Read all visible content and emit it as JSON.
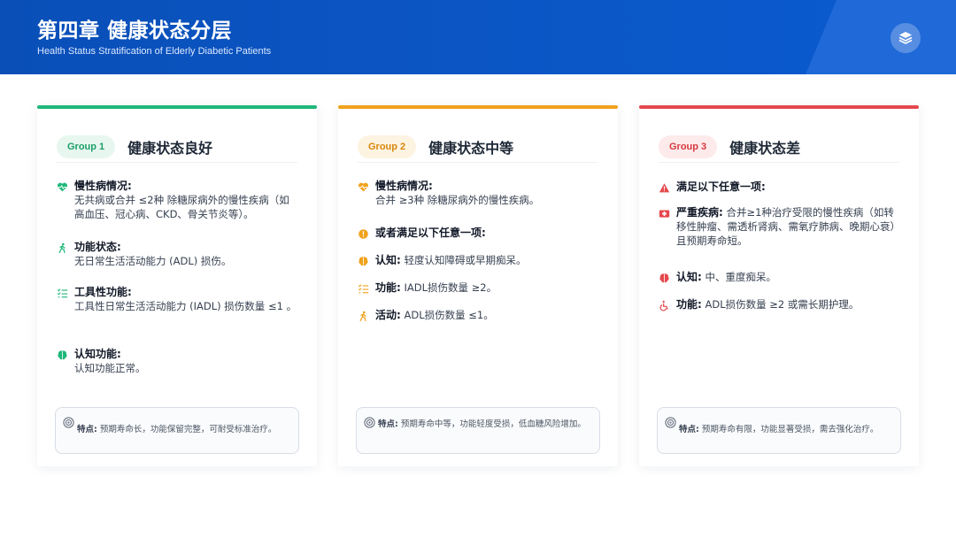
{
  "header": {
    "title": "第四章 健康状态分层",
    "subtitle": "Health Status Stratification of Elderly Diabetic Patients",
    "icon": "layers-icon"
  },
  "colors": {
    "green": "#1fb87a",
    "orange": "#f0a21c",
    "red": "#e5484d",
    "header_blue": "#0b57c7"
  },
  "cards": [
    {
      "group": "Group 1",
      "title": "健康状态良好",
      "items": [
        {
          "icon": "heart-pulse-icon",
          "label": "慢性病情况:",
          "text": "无共病或合并 ≤2种 除糖尿病外的慢性疾病（如高血压、冠心病、CKD、骨关节炎等）。"
        },
        {
          "icon": "walking-icon",
          "label": "功能状态:",
          "text": "无日常生活活动能力 (ADL) 损伤。"
        },
        {
          "icon": "checklist-icon",
          "label": "工具性功能:",
          "text": "工具性日常生活活动能力 (IADL) 损伤数量 ≤1 。"
        },
        {
          "icon": "brain-icon",
          "label": "认知功能:",
          "text": "认知功能正常。"
        }
      ],
      "note_label": "特点:",
      "note_text": "预期寿命长，功能保留完整，可耐受标准治疗。"
    },
    {
      "group": "Group 2",
      "title": "健康状态中等",
      "items": [
        {
          "icon": "heart-pulse-icon",
          "label": "慢性病情况:",
          "text": "合并 ≥3种 除糖尿病外的慢性疾病。"
        },
        {
          "icon": "alert-circle-icon",
          "label": "或者满足以下任意一项:",
          "text": ""
        },
        {
          "icon": "brain-icon",
          "label": "认知:",
          "text": "轻度认知障碍或早期痴呆。"
        },
        {
          "icon": "checklist-icon",
          "label": "功能:",
          "text": "IADL损伤数量 ≥2。"
        },
        {
          "icon": "walking-icon",
          "label": "活动:",
          "text": "ADL损伤数量 ≤1。"
        }
      ],
      "note_label": "特点:",
      "note_text": "预期寿命中等，功能轻度受损，低血糖风险增加。"
    },
    {
      "group": "Group 3",
      "title": "健康状态差",
      "items": [
        {
          "icon": "warning-triangle-icon",
          "label": "满足以下任意一项:",
          "text": ""
        },
        {
          "icon": "hospital-bed-icon",
          "label": "严重疾病:",
          "text": "合并≥1种治疗受限的慢性疾病（如转移性肿瘤、需透析肾病、需氧疗肺病、晚期心衰）且预期寿命短。"
        },
        {
          "icon": "brain-icon",
          "label": "认知:",
          "text": "中、重度痴呆。"
        },
        {
          "icon": "wheelchair-icon",
          "label": "功能:",
          "text": "ADL损伤数量 ≥2 或需长期护理。"
        }
      ],
      "note_label": "特点:",
      "note_text": "预期寿命有限，功能显著受损，需去强化治疗。"
    }
  ]
}
